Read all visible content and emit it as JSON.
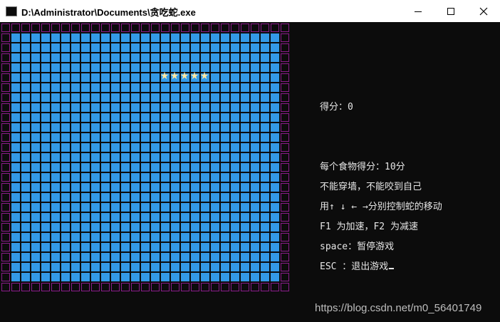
{
  "window": {
    "title": "D:\\Administrator\\Documents\\贪吃蛇.exe",
    "controls": [
      "minimize",
      "maximize",
      "close"
    ]
  },
  "game": {
    "colors": {
      "wall": "#8b1c8b",
      "field": "#3399e6",
      "snake": "#ffe9a6"
    },
    "snake_glyph": "★",
    "snake_length": 5
  },
  "info": {
    "score": "得分：0",
    "food_score": "每个食物得分：10分",
    "rule": "不能穿墙，不能咬到自己",
    "controls": "用↑ ↓ ← →分别控制蛇的移动",
    "speed": "F1 为加速，F2 为减速",
    "pause": "space：暂停游戏",
    "exit": "ESC ：退出游戏"
  },
  "watermark": "https://blog.csdn.net/m0_56401749"
}
